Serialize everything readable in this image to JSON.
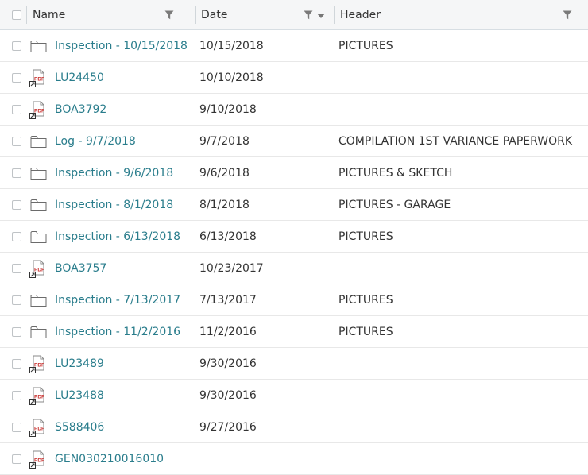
{
  "header": {
    "col_name": "Name",
    "col_date": "Date",
    "col_header": "Header"
  },
  "rows": [
    {
      "type": "folder",
      "name": "Inspection - 10/15/2018",
      "date": "10/15/2018",
      "header": "PICTURES"
    },
    {
      "type": "pdf",
      "name": "LU24450",
      "date": "10/10/2018",
      "header": ""
    },
    {
      "type": "pdf",
      "name": "BOA3792",
      "date": "9/10/2018",
      "header": ""
    },
    {
      "type": "folder",
      "name": "Log - 9/7/2018",
      "date": "9/7/2018",
      "header": "COMPILATION 1ST VARIANCE PAPERWORK"
    },
    {
      "type": "folder",
      "name": "Inspection - 9/6/2018",
      "date": "9/6/2018",
      "header": "PICTURES & SKETCH"
    },
    {
      "type": "folder",
      "name": "Inspection - 8/1/2018",
      "date": "8/1/2018",
      "header": "PICTURES - GARAGE"
    },
    {
      "type": "folder",
      "name": "Inspection - 6/13/2018",
      "date": "6/13/2018",
      "header": "PICTURES"
    },
    {
      "type": "pdf",
      "name": "BOA3757",
      "date": "10/23/2017",
      "header": ""
    },
    {
      "type": "folder",
      "name": "Inspection - 7/13/2017",
      "date": "7/13/2017",
      "header": "PICTURES"
    },
    {
      "type": "folder",
      "name": "Inspection - 11/2/2016",
      "date": "11/2/2016",
      "header": "PICTURES"
    },
    {
      "type": "pdf",
      "name": "LU23489",
      "date": "9/30/2016",
      "header": ""
    },
    {
      "type": "pdf",
      "name": "LU23488",
      "date": "9/30/2016",
      "header": ""
    },
    {
      "type": "pdf",
      "name": "S588406",
      "date": "9/27/2016",
      "header": ""
    },
    {
      "type": "pdf",
      "name": "GEN030210016010",
      "date": "",
      "header": ""
    }
  ],
  "icons": {
    "folder": "folder-icon",
    "pdf": "pdf-file-icon",
    "filter": "filter-icon",
    "sort": "sort-descending-icon"
  },
  "colors": {
    "link": "#2a7d8c",
    "pdf_red": "#c8312f",
    "header_bg": "#f5f6f7"
  }
}
